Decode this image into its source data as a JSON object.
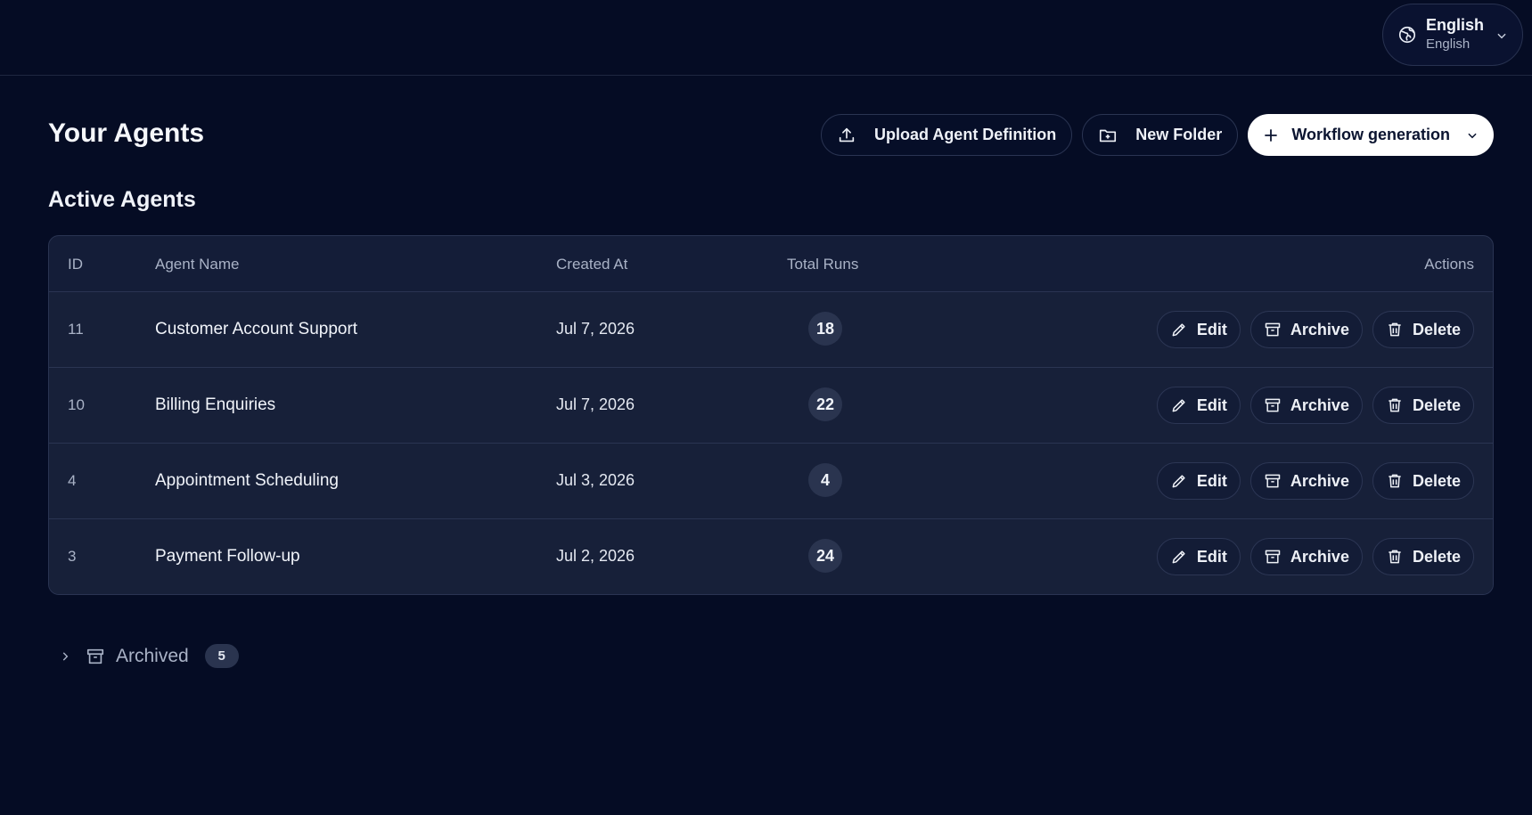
{
  "language": {
    "primary": "English",
    "secondary": "English"
  },
  "header": {
    "title": "Your Agents",
    "upload_label": "Upload Agent Definition",
    "new_folder_label": "New Folder",
    "workflow_label": "Workflow generation"
  },
  "section": {
    "title": "Active Agents"
  },
  "table": {
    "columns": {
      "id": "ID",
      "name": "Agent Name",
      "created": "Created At",
      "runs": "Total Runs",
      "actions": "Actions"
    },
    "rows": [
      {
        "id": "11",
        "name": "Customer Account Support",
        "created": "Jul 7, 2026",
        "runs": "18"
      },
      {
        "id": "10",
        "name": "Billing Enquiries",
        "created": "Jul 7, 2026",
        "runs": "22"
      },
      {
        "id": "4",
        "name": "Appointment Scheduling",
        "created": "Jul 3, 2026",
        "runs": "4"
      },
      {
        "id": "3",
        "name": "Payment Follow-up",
        "created": "Jul 2, 2026",
        "runs": "24"
      }
    ],
    "action_labels": {
      "edit": "Edit",
      "archive": "Archive",
      "delete": "Delete"
    }
  },
  "archived": {
    "label": "Archived",
    "count": "5"
  },
  "icons": {
    "language": "globe-icon",
    "upload": "upload-icon",
    "new_folder": "folder-plus-icon",
    "workflow": "plus-icon",
    "edit": "pencil-icon",
    "archive": "archive-box-icon",
    "delete": "trash-icon"
  },
  "colors": {
    "background": "#050c24",
    "card": "#141d38",
    "primary_button": "#ffffff"
  }
}
